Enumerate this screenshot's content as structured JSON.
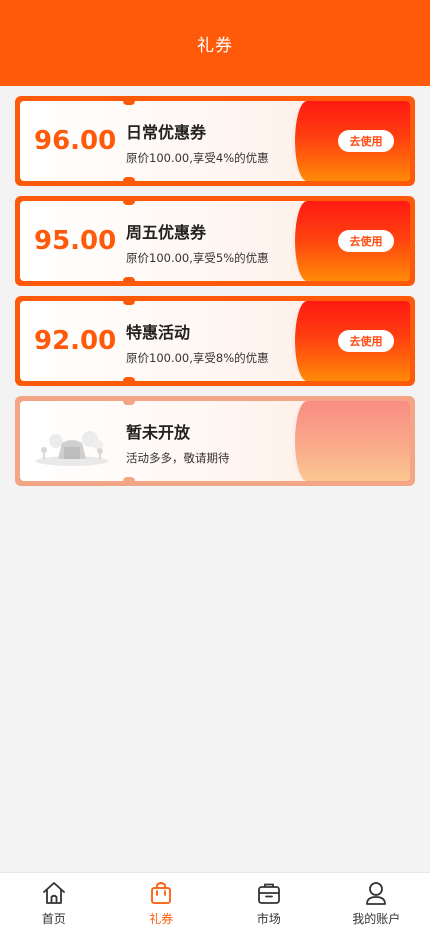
{
  "header": {
    "title": "礼券"
  },
  "coupons": [
    {
      "amount": "96.00",
      "name": "日常优惠券",
      "desc": "原价100.00,享受4%的优惠",
      "button": "去使用"
    },
    {
      "amount": "95.00",
      "name": "周五优惠券",
      "desc": "原价100.00,享受5%的优惠",
      "button": "去使用"
    },
    {
      "amount": "92.00",
      "name": "特惠活动",
      "desc": "原价100.00,享受8%的优惠",
      "button": "去使用"
    }
  ],
  "placeholder": {
    "name": "暂未开放",
    "desc": "活动多多，敬请期待",
    "icon": "empty-state-illustration"
  },
  "tabbar": [
    {
      "label": "首页",
      "icon": "home-icon",
      "active": false
    },
    {
      "label": "礼券",
      "icon": "gift-bag-icon",
      "active": true
    },
    {
      "label": "市场",
      "icon": "briefcase-icon",
      "active": false
    },
    {
      "label": "我的账户",
      "icon": "user-icon",
      "active": false
    }
  ],
  "colors": {
    "brand": "#ff5a0a",
    "background": "#f3f3f3",
    "active_tab": "#ff5a0a"
  }
}
